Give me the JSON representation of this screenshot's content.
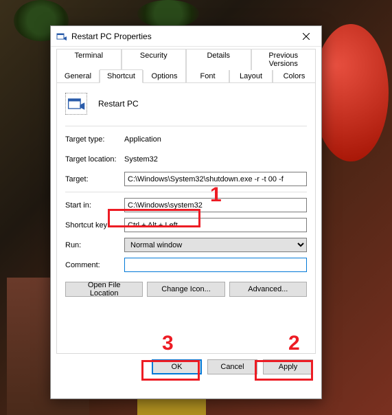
{
  "window": {
    "title": "Restart PC Properties"
  },
  "tabs_row1": [
    {
      "label": "Terminal"
    },
    {
      "label": "Security"
    },
    {
      "label": "Details"
    },
    {
      "label": "Previous Versions"
    }
  ],
  "tabs_row2": [
    {
      "label": "General"
    },
    {
      "label": "Shortcut"
    },
    {
      "label": "Options"
    },
    {
      "label": "Font"
    },
    {
      "label": "Layout"
    },
    {
      "label": "Colors"
    }
  ],
  "shortcut_name": "Restart PC",
  "fields": {
    "target_type_label": "Target type:",
    "target_type_value": "Application",
    "target_location_label": "Target location:",
    "target_location_value": "System32",
    "target_label": "Target:",
    "target_value": "C:\\Windows\\System32\\shutdown.exe -r -t 00 -f",
    "start_in_label": "Start in:",
    "start_in_value": "C:\\Windows\\system32",
    "shortcut_key_label": "Shortcut key:",
    "shortcut_key_value": "Ctrl + Alt + Left",
    "run_label": "Run:",
    "run_value": "Normal window",
    "comment_label": "Comment:",
    "comment_value": ""
  },
  "buttons": {
    "open_file_location": "Open File Location",
    "change_icon": "Change Icon...",
    "advanced": "Advanced...",
    "ok": "OK",
    "cancel": "Cancel",
    "apply": "Apply"
  },
  "annotations": {
    "n1": "1",
    "n2": "2",
    "n3": "3"
  }
}
